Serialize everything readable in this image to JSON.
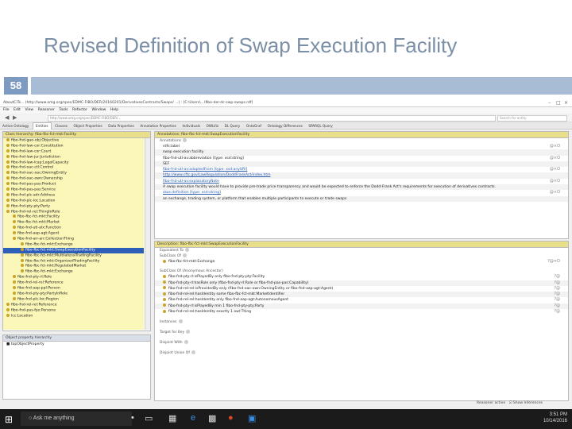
{
  "slide": {
    "title": "Revised Definition of Swap Execution Facility",
    "number": "58"
  },
  "app": {
    "window_title": "AboutCiTs... (http://www.omg.org/spec/EDMC-FIBO/DER/20160201/DerivativesContracts/Swaps/ ...) : [C:\\Users\\...\\fibo-der-dc-swp-swaps.rdf]",
    "menu": [
      "File",
      "Edit",
      "View",
      "Reasoner",
      "Tools",
      "Refactor",
      "Window",
      "Help"
    ],
    "breadcrumb": "http://www.omg.org/spec/EDMC-FIBO/DER/...",
    "search_placeholder": "Search for entity",
    "tabs": [
      "Active Ontology",
      "Entities",
      "Classes",
      "Object Properties",
      "Data Properties",
      "Annotation Properties",
      "Individuals",
      "OWLViz",
      "DL Query",
      "OntoGraf",
      "Ontology Differences",
      "SPARQL Query"
    ],
    "active_tab": "Entities",
    "left_header": "Class hierarchy: fibo-fbc-fct-mkt:Facility",
    "tree": [
      "fibo-fnd-gao-obj:Objective",
      "fibo-fnd-law-cor:Constitution",
      "fibo-fnd-law-cor:Court",
      "fibo-fnd-law-jur:Jurisdiction",
      "fibo-fnd-law-lcap:LegalCapacity",
      "fibo-fnd-oac-ctl:Control",
      "fibo-fnd-oac-oac:OwningEntity",
      "fibo-fnd-oac-own:Ownership",
      "fibo-fnd-pas-pas:Product",
      "fibo-fnd-pas-pas:Service",
      "fibo-fnd-plc-adr:Address",
      "fibo-fnd-plc-loc:Location",
      "fibo-fnd-pty-pty:Party",
      "fibo-fnd-rel-rel:ThingInRole",
      "fibo-fbc-fct-mkt:Facility",
      "fibo-fbc-fct-mkt:Market",
      "fibo-fnd-utl-alx:Function",
      "fibo-fnd-aap-agt:Agent",
      "fibo-fnd-arr-arr:CollectionThing",
      "fibo-fbc-fct-mkt:Exchange",
      "fibo-fbc-fct-mkt:SwapExecutionFacility",
      "fibo-fbc-fct-mkt:MultilateralTradingFacility",
      "fibo-fbc-fct-mkt:OrganizedTradingFacility",
      "fibo-fbc-fct-mkt:RegulatedMarket",
      "fibo-fbc-fct-mkt:Exchange",
      "fibo-fnd-pty-rl:Role",
      "fibo-fnd-rel-rel:Reference",
      "fibo-fnd-aap-ppl:Person",
      "fibo-fnd-pty-pty:PartyInRole",
      "fibo-fnd-plc-loc:Region",
      "fibo-fnd-rel-rel:Reference",
      "fibo-fnd-pas-fps:Persona",
      "lcc:Location"
    ],
    "selected_tree_item": "fibo-fbc-fct-mkt:SwapExecutionFacility",
    "lower_header": "Object property hierarchy",
    "lower_items": [
      "topObjectProperty"
    ],
    "annot_header": "Annotations: fibo-fbc-fct-mkt:SwapExecutionFacility",
    "annot_section": "Annotations",
    "annotations": [
      {
        "text": "rdfs:label",
        "link": false
      },
      {
        "text": "swap execution facility",
        "link": false
      },
      {
        "text": "fibo-fnd-utl-av:abbreviation   [type: xsd:string]",
        "link": false
      },
      {
        "text": "SEF",
        "link": false
      },
      {
        "text": "fibo-fnd-utl-av:adaptedFrom   [type: xsd:anyURI]",
        "link": true
      },
      {
        "text": "http://www.cftc.gov/LawRegulation/DoddFrankAct/index.htm",
        "link": true
      },
      {
        "text": "fibo-fnd-utl-av:explanatoryNote",
        "link": true
      },
      {
        "text": "A swap execution facility would have to provide pre-trade price transparency and would be expected to enforce the Dodd-Frank Act's requirements for execution of derivatives contracts.",
        "link": false
      },
      {
        "text": "skos:definition   [type: xsd:string]",
        "link": true
      },
      {
        "text": "an exchange, trading system, or platform that enables multiple participants to execute or trade swaps",
        "link": false
      }
    ],
    "desc_header": "Description: fibo-fbc-fct-mkt:SwapExecutionFacility",
    "desc_sections": {
      "equivalent": "Equivalent To",
      "subclass": "SubClass Of",
      "inherited": "SubClass Of (Anonymous Ancestor)",
      "instances": "Instances",
      "target_keys": "Target for Key",
      "disjoint": "Disjoint With",
      "disjoint_union": "Disjoint Union Of"
    },
    "subclass_items": [
      "fibo-fbc-fct-mkt:Exchange"
    ],
    "ancestors": [
      "fibo-fnd-pty-rl:isPlayedBy only fibo-fnd-pty-pty:Facility",
      "fibo-fnd-pty-rl:hasRole only (fibo-fnd-pty-rl:Role or fibo-fnd-pas-pas:Capability)",
      "fibo-fnd-rel-rel:isProvidedBy only (fibo-fnd-oac-own:OwningEntity or fibo-fnd-aap-agt:Agent)",
      "fibo-fnd-rel-rel:hasIdentity some fibo-fbc-fct-mkt:MarketIdentifier",
      "fibo-fnd-rel-rel:hasIdentity only fibo-fnd-aap-agt:AutonomousAgent",
      "fibo-fnd-pty-rl:isPlayedBy min 1 fibo-fnd-pty-pty:Party",
      "fibo-fnd-rel-rel:hasIdentity exactly 1 owl:Thing"
    ],
    "status": [
      "Reasoner active",
      "Show Inferences"
    ]
  },
  "taskbar": {
    "search_text": "Ask me anything",
    "time": "3:51 PM",
    "date": "10/14/2016"
  }
}
